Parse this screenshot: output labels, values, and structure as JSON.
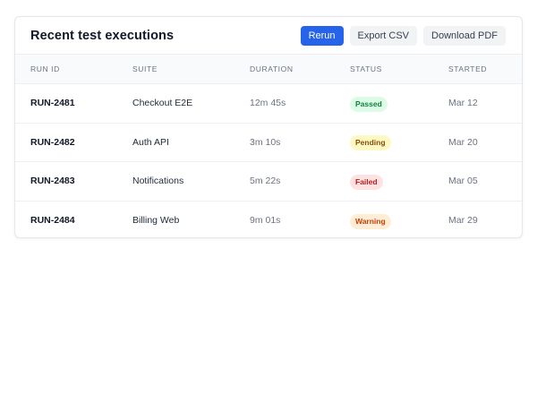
{
  "header": {
    "title": "Recent test executions",
    "buttons": {
      "rerun": "Rerun",
      "export_csv": "Export CSV",
      "download_pdf": "Download PDF"
    }
  },
  "table": {
    "columns": [
      "RUN ID",
      "SUITE",
      "DURATION",
      "STATUS",
      "STARTED"
    ],
    "rows": [
      {
        "run_id": "RUN-2481",
        "suite": "Checkout E2E",
        "duration": "12m 45s",
        "status": "Passed",
        "started": "Mar 12"
      },
      {
        "run_id": "RUN-2482",
        "suite": "Auth API",
        "duration": "3m 10s",
        "status": "Pending",
        "started": "Mar 20"
      },
      {
        "run_id": "RUN-2483",
        "suite": "Notifications",
        "duration": "5m 22s",
        "status": "Failed",
        "started": "Mar 05"
      },
      {
        "run_id": "RUN-2484",
        "suite": "Billing Web",
        "duration": "9m 01s",
        "status": "Warning",
        "started": "Mar 29"
      }
    ]
  },
  "colors": {
    "primary": "#2563eb",
    "status": {
      "Passed": {
        "bg": "#dcfce7",
        "fg": "#15803d"
      },
      "Pending": {
        "bg": "#fef9c3",
        "fg": "#854d0e"
      },
      "Failed": {
        "bg": "#fee2e2",
        "fg": "#b91c1c"
      },
      "Warning": {
        "bg": "#ffedd5",
        "fg": "#c2410c"
      }
    }
  }
}
